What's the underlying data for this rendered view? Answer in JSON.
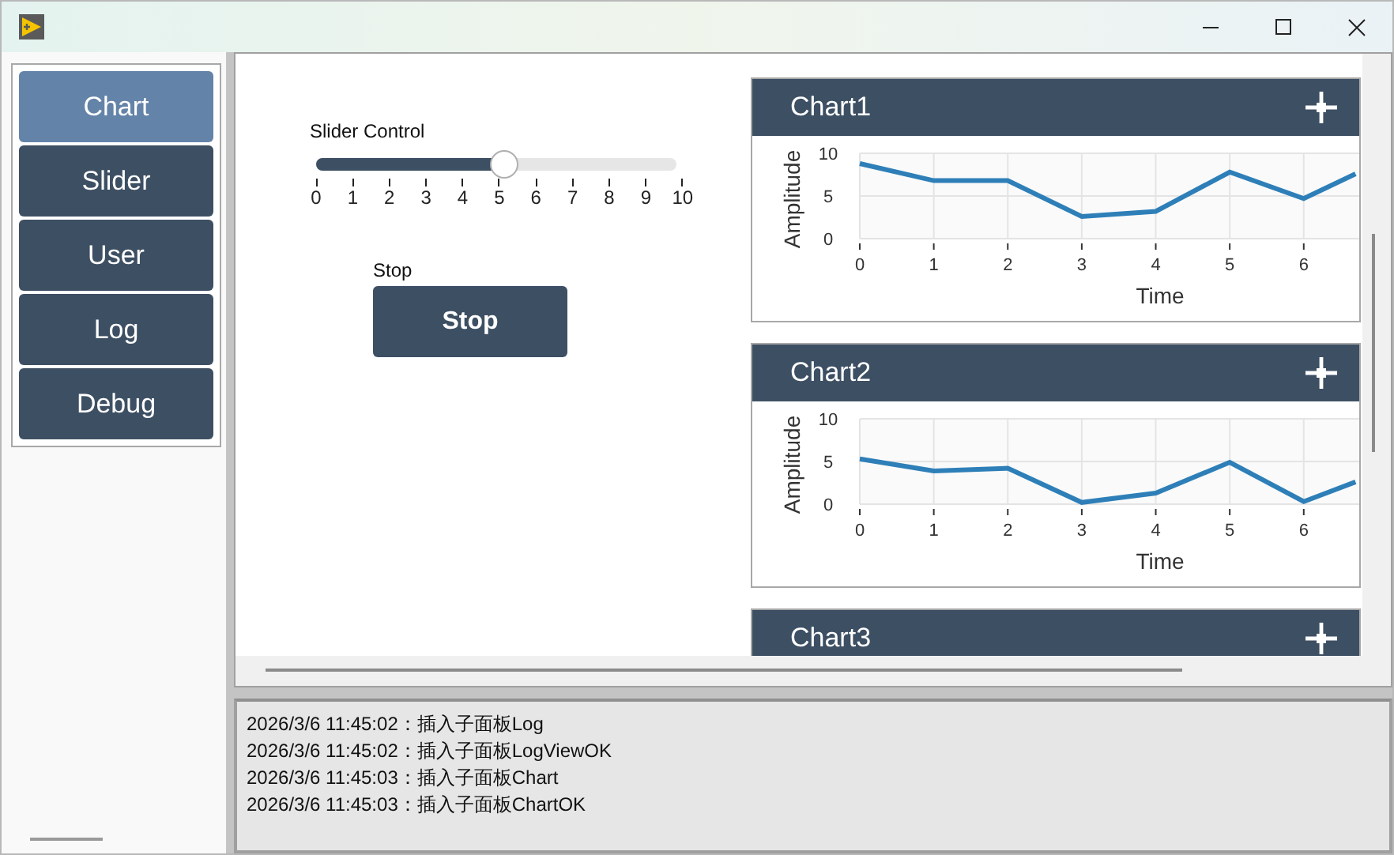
{
  "nav": [
    {
      "label": "Chart",
      "selected": true
    },
    {
      "label": "Slider",
      "selected": false
    },
    {
      "label": "User",
      "selected": false
    },
    {
      "label": "Log",
      "selected": false
    },
    {
      "label": "Debug",
      "selected": false
    }
  ],
  "slider": {
    "label": "Slider Control",
    "level": 0.52,
    "ticks": [
      "0",
      "1",
      "2",
      "3",
      "4",
      "5",
      "6",
      "7",
      "8",
      "9",
      "10"
    ]
  },
  "stop": {
    "caption": "Stop",
    "button": "Stop"
  },
  "charts": [
    {
      "title": "Chart1",
      "chart_data": {
        "type": "line",
        "xlabel": "Time",
        "ylabel": "Amplitude",
        "x": [
          0,
          1,
          2,
          3,
          4,
          5,
          6,
          6.7
        ],
        "xlim": [
          0,
          6.75
        ],
        "ylim": [
          0,
          10
        ],
        "xticks": [
          0,
          1,
          2,
          3,
          4,
          5,
          6
        ],
        "yticks": [
          0,
          5,
          10
        ],
        "grid": true,
        "series": [
          {
            "color": "#2e7fb8",
            "values": [
              8.8,
              6.8,
              6.8,
              2.6,
              3.2,
              7.8,
              4.7,
              7.6
            ]
          }
        ]
      }
    },
    {
      "title": "Chart2",
      "chart_data": {
        "type": "line",
        "xlabel": "Time",
        "ylabel": "Amplitude",
        "x": [
          0,
          1,
          2,
          3,
          4,
          5,
          6,
          6.7
        ],
        "xlim": [
          0,
          6.75
        ],
        "ylim": [
          0,
          10
        ],
        "xticks": [
          0,
          1,
          2,
          3,
          4,
          5,
          6
        ],
        "yticks": [
          0,
          5,
          10
        ],
        "grid": true,
        "series": [
          {
            "color": "#2e7fb8",
            "values": [
              5.3,
              3.9,
              4.2,
              0.2,
              1.3,
              4.9,
              0.3,
              2.6
            ]
          }
        ]
      }
    },
    {
      "title": "Chart3"
    }
  ],
  "log": {
    "lines": [
      "2026/3/6 11:45:02：插入子面板Log",
      "2026/3/6 11:45:02：插入子面板LogViewOK",
      "2026/3/6 11:45:03：插入子面板Chart",
      "2026/3/6 11:45:03：插入子面板ChartOK"
    ]
  }
}
